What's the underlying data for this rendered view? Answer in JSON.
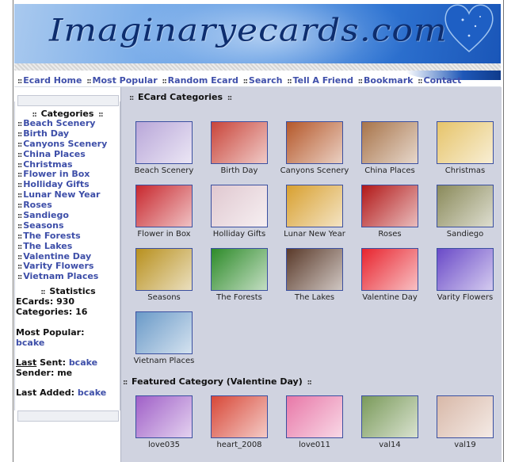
{
  "banner": {
    "logo_text": "Imaginaryecards.com"
  },
  "nav": {
    "items": [
      {
        "label": "Ecard Home"
      },
      {
        "label": "Most Popular"
      },
      {
        "label": "Random Ecard"
      },
      {
        "label": "Search"
      },
      {
        "label": "Tell A Friend"
      },
      {
        "label": "Bookmark"
      },
      {
        "label": "Contact"
      }
    ],
    "separator": "::"
  },
  "sidebar": {
    "categories_title": "Categories",
    "categories": [
      "Beach Scenery",
      "Birth Day",
      "Canyons Scenery",
      "China Places",
      "Christmas",
      "Flower in Box",
      "Holliday Gifts",
      "Lunar New Year",
      "Roses",
      "Sandiego",
      "Seasons",
      "The Forests",
      "The Lakes",
      "Valentine Day",
      "Varity Flowers",
      "Vietnam Places"
    ],
    "statistics_title": "Statistics",
    "ecards_label": "ECards:",
    "ecards_value": "930",
    "categories_label": "Categories:",
    "categories_value": "16",
    "most_popular_label": "Most Popular:",
    "most_popular_value": "bcake",
    "last_link": "Last",
    "sent_label": "Sent:",
    "sent_value": "bcake",
    "sender_label": "Sender:",
    "sender_value": "me",
    "last_added_label": "Last Added:",
    "last_added_value": "bcake"
  },
  "main": {
    "categories_title": "ECard Categories",
    "categories": [
      {
        "label": "Beach Scenery",
        "icon": "beach-scenery-thumbnail",
        "color": "#b9a7d9"
      },
      {
        "label": "Birth Day",
        "icon": "birthday-cake-thumbnail",
        "color": "#c9453a"
      },
      {
        "label": "Canyons Scenery",
        "icon": "canyon-thumbnail",
        "color": "#b5582a"
      },
      {
        "label": "China Places",
        "icon": "china-rocks-thumbnail",
        "color": "#a8744a"
      },
      {
        "label": "Christmas",
        "icon": "christmas-card-thumbnail",
        "color": "#e6c46a"
      },
      {
        "label": "Flower in Box",
        "icon": "flower-box-thumbnail",
        "color": "#c8282e"
      },
      {
        "label": "Holliday Gifts",
        "icon": "gift-thumbnail",
        "color": "#e0c8d0"
      },
      {
        "label": "Lunar New Year",
        "icon": "lunar-new-year-thumbnail",
        "color": "#d8a030"
      },
      {
        "label": "Roses",
        "icon": "rose-thumbnail",
        "color": "#b21818"
      },
      {
        "label": "Sandiego",
        "icon": "sandiego-cactus-thumbnail",
        "color": "#8a8a5a"
      },
      {
        "label": "Seasons",
        "icon": "autumn-forest-thumbnail",
        "color": "#b8901e"
      },
      {
        "label": "The Forests",
        "icon": "fern-forest-thumbnail",
        "color": "#2e8b2a"
      },
      {
        "label": "The Lakes",
        "icon": "lake-thumbnail",
        "color": "#5a3a2a"
      },
      {
        "label": "Valentine Day",
        "icon": "valentine-hearts-thumbnail",
        "color": "#e8242e"
      },
      {
        "label": "Varity Flowers",
        "icon": "lotus-flower-thumbnail",
        "color": "#6a4ac8"
      },
      {
        "label": "Vietnam Places",
        "icon": "vietnam-coast-thumbnail",
        "color": "#6a9ac8"
      }
    ],
    "featured_title": "Featured Category (Valentine Day)",
    "featured": [
      {
        "label": "love035",
        "icon": "love-basket-thumbnail",
        "color": "#a060c8"
      },
      {
        "label": "heart_2008",
        "icon": "heart-wreath-thumbnail",
        "color": "#d84838"
      },
      {
        "label": "love011",
        "icon": "heart-bouquet-thumbnail",
        "color": "#e878a8"
      },
      {
        "label": "val14",
        "icon": "val14-card-thumbnail",
        "color": "#7a9a5a"
      },
      {
        "label": "val19",
        "icon": "val19-card-thumbnail",
        "color": "#d8b8a8"
      }
    ]
  }
}
